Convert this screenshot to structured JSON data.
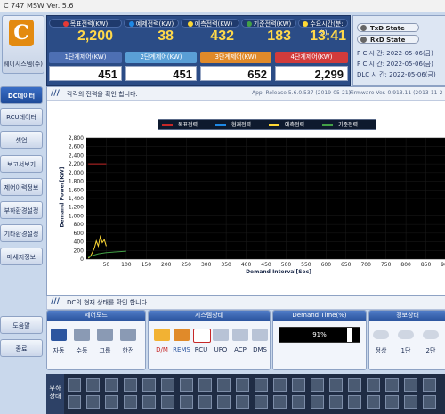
{
  "window": {
    "title": "C 747 MSW Ver. 5.6"
  },
  "logo": {
    "mark": "C",
    "text": "웨이시스템(주)"
  },
  "power": {
    "items": [
      {
        "label": "목표전력(KW)",
        "dot_color": "#e53935",
        "value": "2,200"
      },
      {
        "label": "예제전력(KW)",
        "dot_color": "#1e88e5",
        "value": "38"
      },
      {
        "label": "예측전력(KW)",
        "dot_color": "#fdd835",
        "value": "432"
      },
      {
        "label": "기준전력(KW)",
        "dot_color": "#43a047",
        "value": "183"
      },
      {
        "label": "수요시간(분:초)",
        "dot_color": "#fdd835",
        "value": "13:41"
      }
    ],
    "limits": [
      {
        "label": "1단계제어(KW)",
        "color": "#4d6fb3",
        "value": "451"
      },
      {
        "label": "2단계제어(KW)",
        "color": "#5a9fd6",
        "value": "451"
      },
      {
        "label": "3단계제어(KW)",
        "color": "#e08a2a",
        "value": "652"
      },
      {
        "label": "4단계제어(KW)",
        "color": "#d23b3b",
        "value": "2,299"
      }
    ]
  },
  "state": {
    "txd": "TxD State",
    "rxd": "RxD State",
    "times": [
      {
        "label": "P C 시 간:",
        "value": "2022-05-06(금)"
      },
      {
        "label": "P C 시 간:",
        "value": "2022-05-06(금)"
      },
      {
        "label": "DLC 시 간:",
        "value": "2022-05-06(금)"
      }
    ]
  },
  "sidebar": {
    "items": [
      {
        "label": "DC데이터",
        "active": true
      },
      {
        "label": "RCU데이터",
        "active": false
      },
      {
        "label": "셋업",
        "active": false
      },
      {
        "label": "보고서보기",
        "active": false
      },
      {
        "label": "제어이력정보",
        "active": false
      },
      {
        "label": "부하환경설정",
        "active": false
      },
      {
        "label": "기타환경설정",
        "active": false
      },
      {
        "label": "메세지정보",
        "active": false
      }
    ],
    "help": "도움말",
    "exit": "종료"
  },
  "main": {
    "info_text": "각각의 전력을 확인 합니다.",
    "release": "App. Release 5.6.0.537 (2019-05-21)",
    "firmware": "Firmware Ver. 0.913.11 (2013-11-2"
  },
  "chart_data": {
    "type": "line",
    "legend": [
      "목표전력",
      "현재전력",
      "예측전력",
      "기준전력"
    ],
    "legend_colors": [
      "#c62828",
      "#1e88e5",
      "#fdd835",
      "#43a047"
    ],
    "ylabel": "Demand Power[KW]",
    "xlabel": "Demand Interval[Sec]",
    "y_ticks": [
      "2,800",
      "2,600",
      "2,400",
      "2,200",
      "2,000",
      "1,800",
      "1,600",
      "1,400",
      "1,200",
      "1,000",
      "800",
      "600",
      "400",
      "200",
      "0"
    ],
    "x_ticks": [
      "50",
      "100",
      "150",
      "200",
      "250",
      "300",
      "350",
      "400",
      "450",
      "500",
      "550",
      "600",
      "650",
      "700",
      "750",
      "800",
      "850",
      "900"
    ],
    "ylim": [
      0,
      2800
    ],
    "xlim": [
      0,
      900
    ],
    "series": [
      {
        "name": "목표전력",
        "color": "#c62828",
        "x": [
          5,
          50
        ],
        "y": [
          2200,
          2200
        ]
      },
      {
        "name": "예측전력",
        "color": "#fdd835",
        "x": [
          5,
          10,
          15,
          20,
          25,
          30,
          35,
          40,
          45,
          50
        ],
        "y": [
          20,
          60,
          150,
          250,
          420,
          300,
          520,
          380,
          450,
          300
        ]
      },
      {
        "name": "기준전력",
        "color": "#43a047",
        "x": [
          5,
          15,
          30,
          50,
          80,
          100
        ],
        "y": [
          40,
          80,
          120,
          150,
          170,
          183
        ]
      }
    ]
  },
  "bottom": {
    "msg": "DC의 현재 상태를 확인 합니다.",
    "mode": {
      "title": "제어모드",
      "items": [
        "자동",
        "수동",
        "그룹",
        "한전"
      ]
    },
    "system": {
      "title": "시스템상태",
      "items": [
        "D/M",
        "REMS",
        "RCU",
        "UFO",
        "ACP",
        "DMS"
      ]
    },
    "demand": {
      "title": "Demand Time(%)",
      "value": "91%",
      "fraction": 0.91
    },
    "alarm": {
      "title": "경보상태",
      "items": [
        "정상",
        "1단",
        "2단"
      ]
    }
  },
  "strip": {
    "label": "부하상태",
    "count": 40
  }
}
